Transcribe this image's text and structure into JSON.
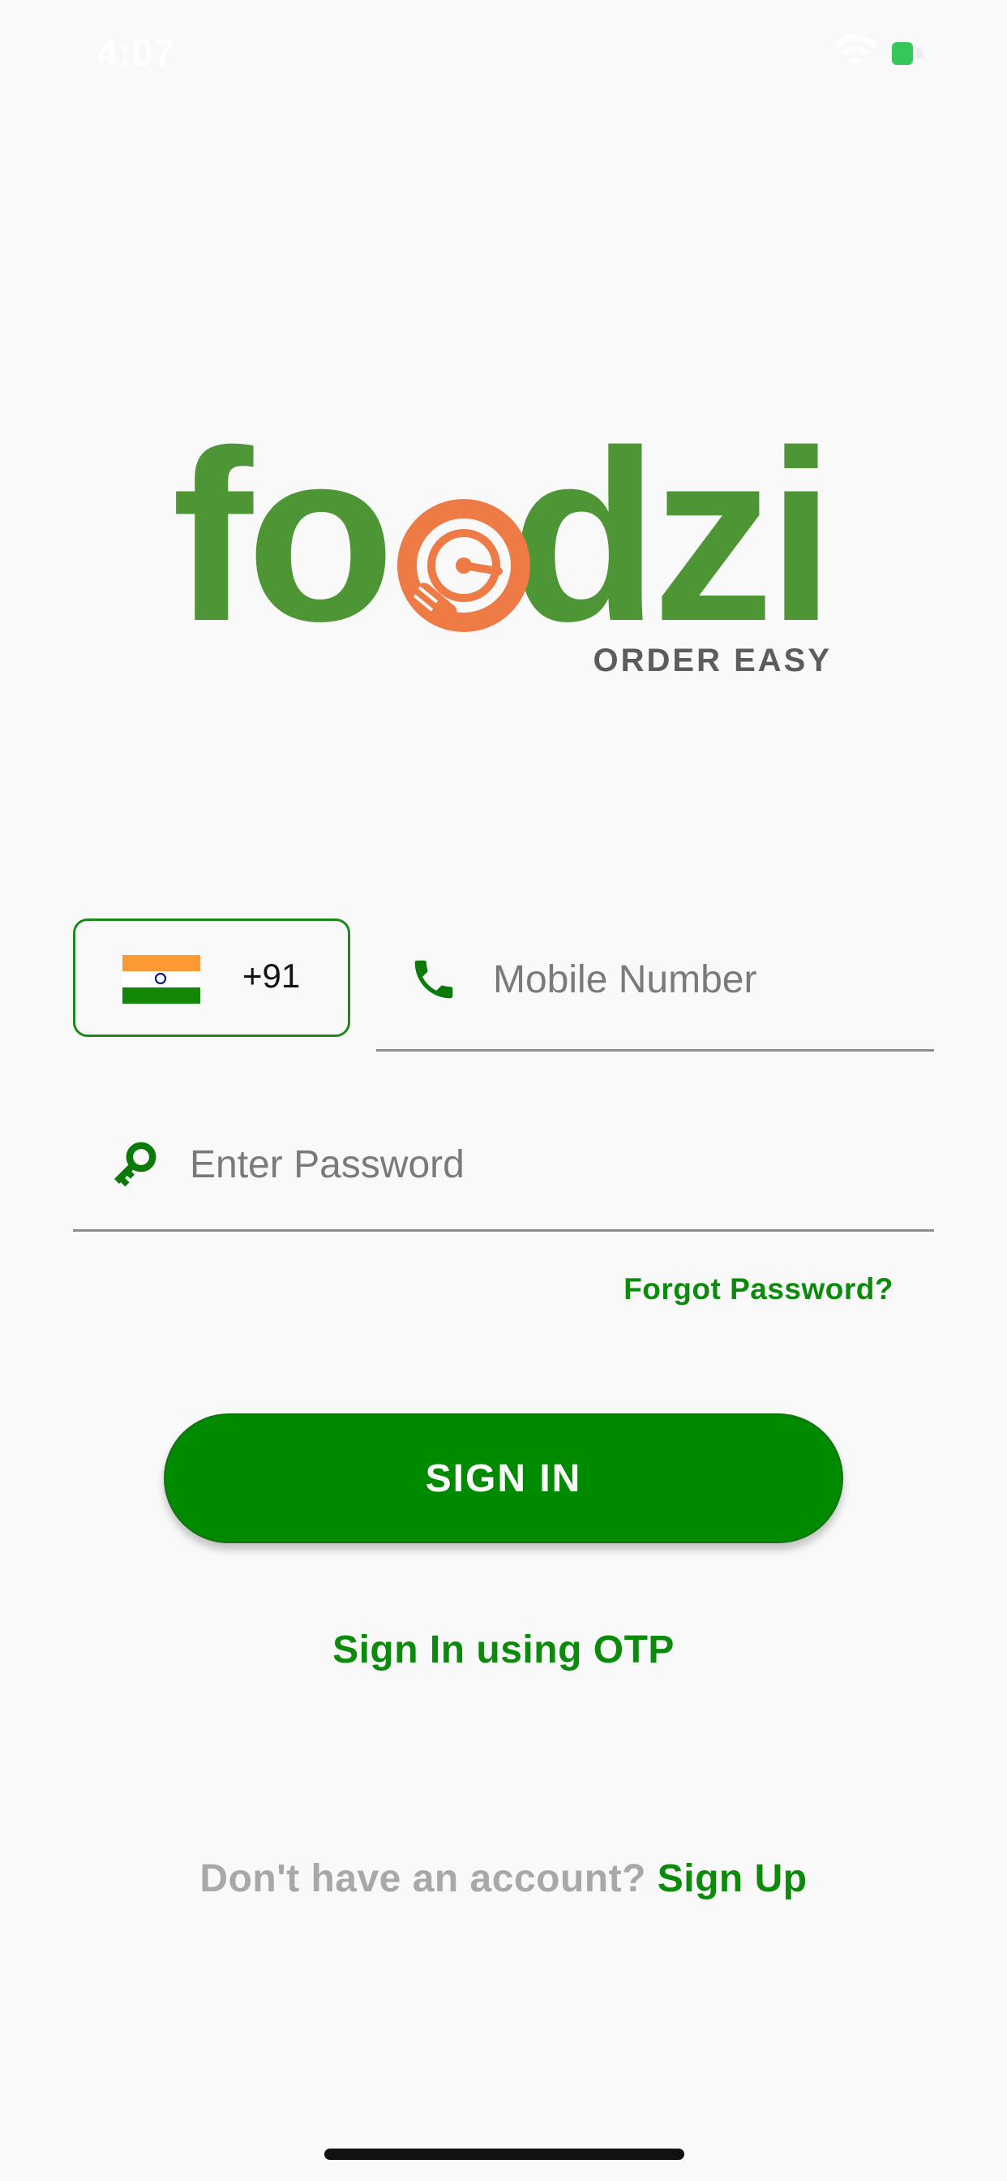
{
  "status_bar": {
    "time": "4:07",
    "battery_color": "#35c759"
  },
  "logo": {
    "word_start": "fo",
    "word_end": "dzi",
    "tagline": "ORDER EASY",
    "brand_green": "#4e9635",
    "brand_orange": "#ee7a46"
  },
  "country": {
    "flag": "india-flag",
    "code": "+91"
  },
  "mobile": {
    "icon": "phone-icon",
    "placeholder": "Mobile Number",
    "value": ""
  },
  "password": {
    "icon": "key-icon",
    "placeholder": "Enter Password",
    "value": ""
  },
  "forgot_password": "Forgot Password?",
  "sign_in_button": "SIGN IN",
  "otp_link": "Sign In using OTP",
  "signup": {
    "prompt": "Don't have an account?",
    "link": "Sign Up"
  },
  "colors": {
    "accent_green": "#008a00",
    "link_green": "#0b8a0b",
    "muted_text": "#a8a8a8"
  }
}
